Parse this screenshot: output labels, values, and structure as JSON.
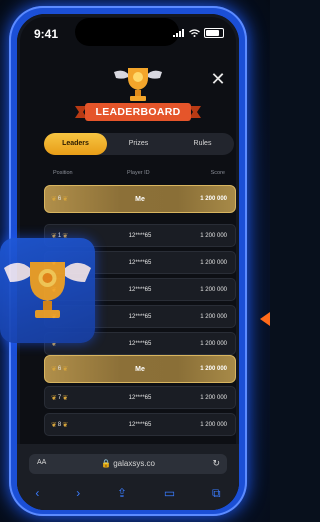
{
  "status": {
    "time": "9:41"
  },
  "header": {
    "banner": "LEADERBOARD"
  },
  "tabs": [
    {
      "label": "Leaders"
    },
    {
      "label": "Prizes"
    },
    {
      "label": "Rules"
    }
  ],
  "columns": {
    "position": "Position",
    "player_id": "Player ID",
    "score": "Score"
  },
  "me_top": {
    "position": "6",
    "player": "Me",
    "score": "1 200 000"
  },
  "rows": [
    {
      "position": "1",
      "player": "12****65",
      "score": "1 200 000"
    },
    {
      "position": "",
      "player": "12****65",
      "score": "1 200 000"
    },
    {
      "position": "",
      "player": "12****65",
      "score": "1 200 000"
    },
    {
      "position": "",
      "player": "12****65",
      "score": "1 200 000"
    },
    {
      "position": "",
      "player": "12****65",
      "score": "1 200 000"
    }
  ],
  "me_mid": {
    "position": "6",
    "player": "Me",
    "score": "1 200 000"
  },
  "rows_after": [
    {
      "position": "7",
      "player": "12****65",
      "score": "1 200 000"
    },
    {
      "position": "8",
      "player": "12****65",
      "score": "1 200 000"
    }
  ],
  "browser": {
    "aa": "AA",
    "url": "galaxsys.co"
  },
  "colors": {
    "accent": "#f2b233",
    "frame": "#1b4fd6",
    "nav": "#3a7cff"
  }
}
